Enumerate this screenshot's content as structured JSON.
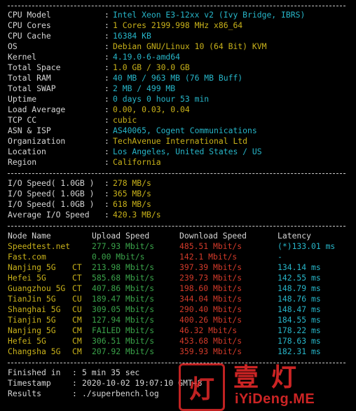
{
  "sysinfo": [
    {
      "label": "CPU Model",
      "value": "Intel Xeon E3-12xx v2 (Ivy Bridge, IBRS)",
      "color": "cyan"
    },
    {
      "label": "CPU Cores",
      "value": "1 Cores 2199.998 MHz x86_64",
      "color": "yellow"
    },
    {
      "label": "CPU Cache",
      "value": "16384 KB",
      "color": "cyan"
    },
    {
      "label": "OS",
      "value": "Debian GNU/Linux 10 (64 Bit) KVM",
      "color": "yellow"
    },
    {
      "label": "Kernel",
      "value": "4.19.0-6-amd64",
      "color": "cyan"
    },
    {
      "label": "Total Space",
      "value": "1.0 GB / 30.0 GB",
      "color": "yellow"
    },
    {
      "label": "Total RAM",
      "value": "40 MB / 963 MB (76 MB Buff)",
      "color": "cyan"
    },
    {
      "label": "Total SWAP",
      "value": "2 MB / 499 MB",
      "color": "cyan"
    },
    {
      "label": "Uptime",
      "value": "0 days 0 hour 53 min",
      "color": "cyan"
    },
    {
      "label": "Load Average",
      "value": "0.00, 0.03, 0.04",
      "color": "yellow"
    },
    {
      "label": "TCP CC",
      "value": "cubic",
      "color": "yellow"
    },
    {
      "label": "ASN & ISP",
      "value": "AS40065, Cogent Communications",
      "color": "cyan"
    },
    {
      "label": "Organization",
      "value": "TechAvenue International Ltd",
      "color": "yellow"
    },
    {
      "label": "Location",
      "value": "Los Angeles, United States / US",
      "color": "cyan"
    },
    {
      "label": "Region",
      "value": "California",
      "color": "yellow"
    }
  ],
  "colon": ":",
  "io": [
    {
      "label": "I/O Speed( 1.0GB )",
      "value": "278 MB/s"
    },
    {
      "label": "I/O Speed( 1.0GB )",
      "value": "365 MB/s"
    },
    {
      "label": "I/O Speed( 1.0GB )",
      "value": "618 MB/s"
    },
    {
      "label": "Average I/O Speed",
      "value": "420.3 MB/s"
    }
  ],
  "speed_table": {
    "headers": {
      "node": "Node Name",
      "upload": "Upload Speed",
      "download": "Download Speed",
      "latency": "Latency"
    },
    "rows": [
      {
        "node": "Speedtest.net",
        "isp": "",
        "upload": "277.93 Mbit/s",
        "download": "485.51 Mbit/s",
        "latency": "(*)133.01 ms"
      },
      {
        "node": "Fast.com",
        "isp": "",
        "upload": "0.00 Mbit/s",
        "download": "142.1 Mbit/s",
        "latency": "-"
      },
      {
        "node": "Nanjing 5G",
        "isp": "CT",
        "upload": "213.98 Mbit/s",
        "download": "397.39 Mbit/s",
        "latency": "134.14 ms"
      },
      {
        "node": "Hefei 5G",
        "isp": "CT",
        "upload": "585.68 Mbit/s",
        "download": "239.73 Mbit/s",
        "latency": "142.55 ms"
      },
      {
        "node": "Guangzhou 5G",
        "isp": "CT",
        "upload": "407.86 Mbit/s",
        "download": "198.60 Mbit/s",
        "latency": "148.79 ms"
      },
      {
        "node": "TianJin 5G",
        "isp": "CU",
        "upload": "189.47 Mbit/s",
        "download": "344.04 Mbit/s",
        "latency": "148.76 ms"
      },
      {
        "node": "Shanghai 5G",
        "isp": "CU",
        "upload": "309.05 Mbit/s",
        "download": "290.40 Mbit/s",
        "latency": "148.47 ms"
      },
      {
        "node": "Tianjin 5G",
        "isp": "CM",
        "upload": "127.94 Mbit/s",
        "download": "400.26 Mbit/s",
        "latency": "184.55 ms"
      },
      {
        "node": "Nanjing 5G",
        "isp": "CM",
        "upload": "FAILED Mbit/s",
        "download": "46.32 Mbit/s",
        "latency": "178.22 ms"
      },
      {
        "node": "Hefei 5G",
        "isp": "CM",
        "upload": "306.51 Mbit/s",
        "download": "453.68 Mbit/s",
        "latency": "178.63 ms"
      },
      {
        "node": "Changsha 5G",
        "isp": "CM",
        "upload": "207.92 Mbit/s",
        "download": "359.93 Mbit/s",
        "latency": "182.31 ms"
      }
    ]
  },
  "footer": [
    {
      "label": "Finished in",
      "value": "5 min 35 sec"
    },
    {
      "label": "Timestamp",
      "value": "2020-10-02 19:07:10 GMT+8"
    },
    {
      "label": "Results",
      "value": "./superbench.log"
    }
  ],
  "watermark": {
    "box_char": "灯",
    "cn": "壹灯",
    "en": "iYiDeng.ME"
  },
  "colors": {
    "cyan": "#27b6c9",
    "yellow": "#c9b21a",
    "red": "#d23a2a",
    "green": "#3aa34a",
    "text": "#d6d6d6",
    "bg": "#000000"
  }
}
